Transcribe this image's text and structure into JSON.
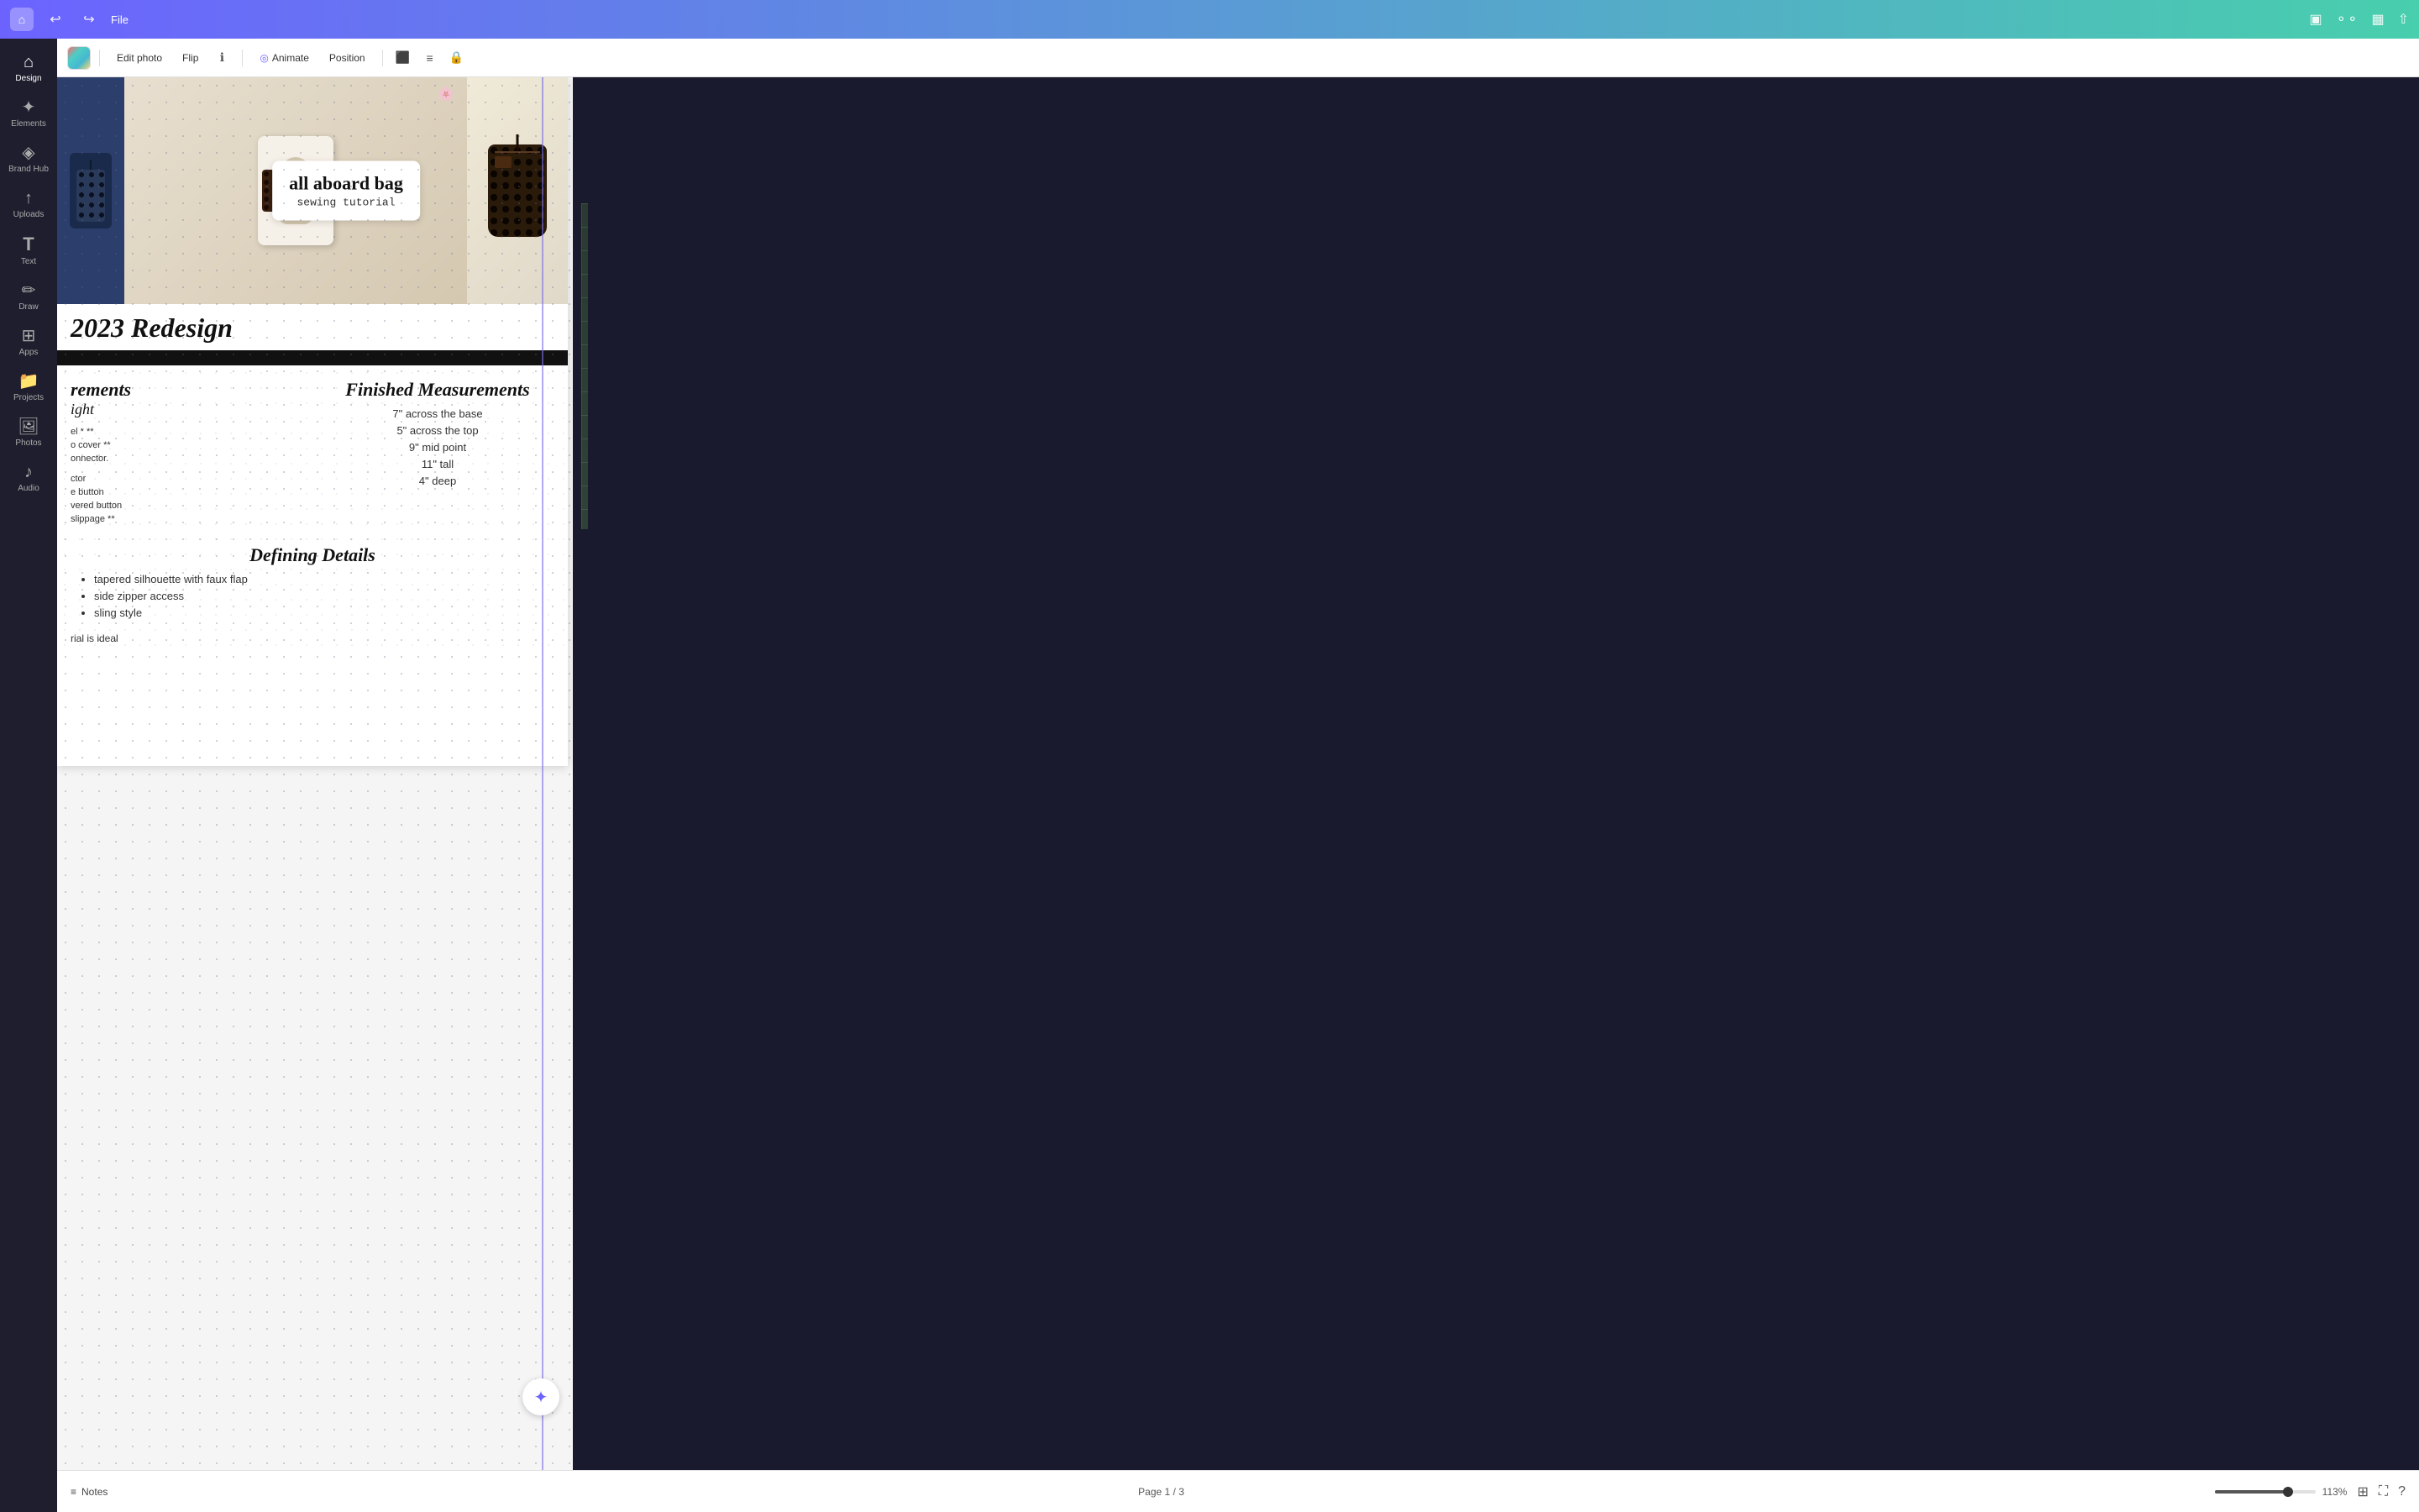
{
  "topbar": {
    "home_icon": "⌂",
    "file_label": "File",
    "undo_icon": "↩",
    "redo_icon": "↪",
    "present_icon": "▣",
    "share_icon": "⇧",
    "collab_icon": "⚬⚬",
    "chart_icon": "▦"
  },
  "edit_toolbar": {
    "edit_photo_label": "Edit photo",
    "flip_label": "Flip",
    "info_icon": "ℹ",
    "animate_icon": "◎",
    "animate_label": "Animate",
    "position_label": "Position",
    "transparency_icon": "⬛",
    "style_icon": "≡",
    "lock_icon": "🔒"
  },
  "sidebar": {
    "items": [
      {
        "id": "design",
        "icon": "⌂",
        "label": "Design"
      },
      {
        "id": "elements",
        "icon": "✦",
        "label": "Elements"
      },
      {
        "id": "brand-hub",
        "icon": "◈",
        "label": "Brand Hub"
      },
      {
        "id": "uploads",
        "icon": "↑",
        "label": "Uploads"
      },
      {
        "id": "text",
        "icon": "T",
        "label": "Text"
      },
      {
        "id": "draw",
        "icon": "✏",
        "label": "Draw"
      },
      {
        "id": "apps",
        "icon": "⊞",
        "label": "Apps"
      },
      {
        "id": "projects",
        "icon": "📁",
        "label": "Projects"
      },
      {
        "id": "photos",
        "icon": "🖼",
        "label": "Photos"
      },
      {
        "id": "audio",
        "icon": "♪",
        "label": "Audio"
      }
    ]
  },
  "canvas": {
    "title_card": {
      "main_title": "all aboard bag",
      "subtitle": "sewing tutorial"
    },
    "redesign_title": "2023 Redesign",
    "measurements": {
      "section_title": "rements",
      "weight_label": "ight",
      "items": [
        "el * **",
        "o cover **",
        "",
        "onnector.",
        "",
        "ctor",
        "e button",
        "vered button",
        "slippage **"
      ],
      "finished_title": "Finished Measurements",
      "finished_items": [
        "7\" across the base",
        "5\" across the top",
        "9\" mid point",
        "11\" tall",
        "4\" deep"
      ]
    },
    "details": {
      "title": "Defining Details",
      "items": [
        "tapered silhouette with faux flap",
        "side zipper access",
        "sling style"
      ]
    },
    "material_note": "rial is ideal"
  },
  "bottom_bar": {
    "notes_icon": "≡",
    "notes_label": "Notes",
    "page_info": "Page 1 / 3",
    "zoom_level": "113%",
    "grid_icon": "⊞",
    "expand_icon": "⛶",
    "help_icon": "?"
  },
  "magic_btn": {
    "icon": "✦"
  }
}
